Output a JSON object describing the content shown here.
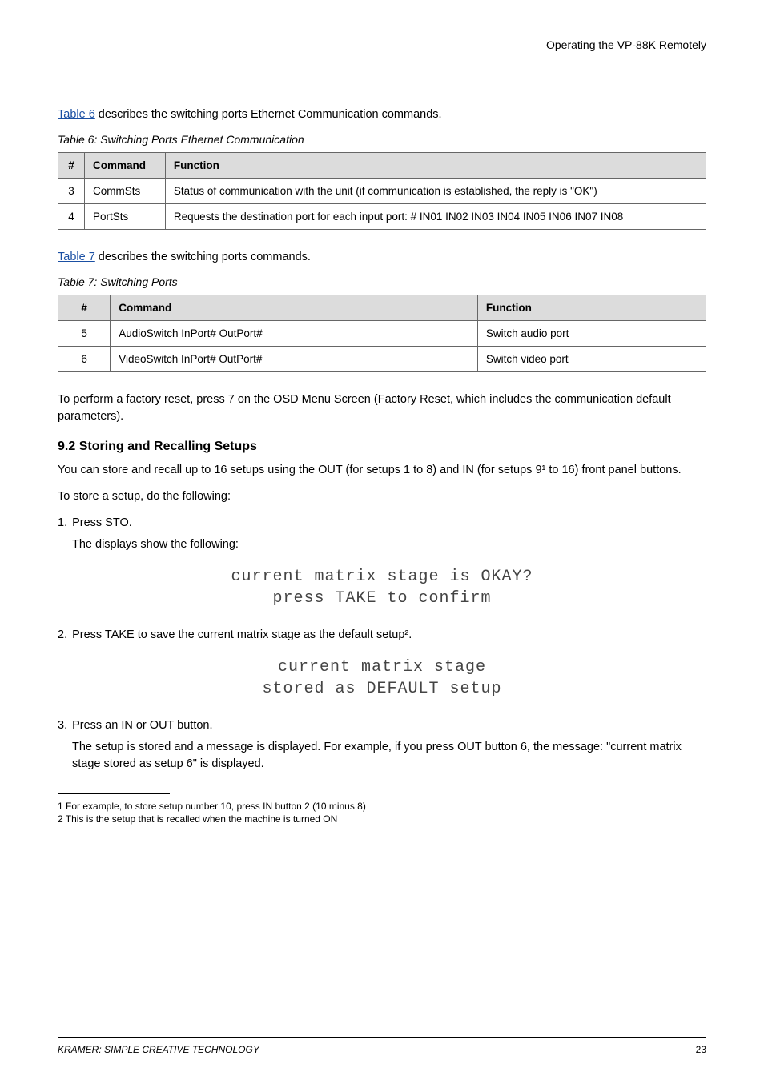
{
  "header": {
    "title": "Operating the VP-88K Remotely"
  },
  "para_sections": {
    "p_intro_t6": "Table 6 describes the switching ports Ethernet Communication commands.",
    "t6_caption": "Table 6: Switching Ports Ethernet Communication",
    "p_intro_t7": "Table 7 describes the switching ports commands.",
    "t7_caption": "Table 7: Switching Ports",
    "p_factory_reset": "To perform a factory reset, press 7 on the OSD Menu Screen (Factory Reset, which includes the communication default parameters)."
  },
  "table6": {
    "headers": [
      "#",
      "Command",
      "Function"
    ],
    "rows": [
      {
        "num": "3",
        "cmd": "CommSts",
        "func": "Status of communication with the unit (if communication is established, the reply is \"OK\")"
      },
      {
        "num": "4",
        "cmd": "PortSts",
        "func": "Requests the destination port for each input port: # IN01 IN02 IN03 IN04 IN05 IN06 IN07 IN08"
      }
    ]
  },
  "table7": {
    "headers": [
      "#",
      "Command",
      "Function"
    ],
    "rows": [
      {
        "num": "5",
        "cmd": "AudioSwitch InPort# OutPort#",
        "func": "Switch audio port"
      },
      {
        "num": "6",
        "cmd": "VideoSwitch InPort# OutPort#",
        "func": "Switch video port"
      }
    ]
  },
  "sections": {
    "s92": "9.2    Storing and Recalling Setups"
  },
  "paras92": {
    "p1": "You can store and recall up to 16 setups using the OUT (for setups 1 to 8) and IN (for setups 9¹ to 16) front panel buttons.",
    "p2": "To store a setup, do the following:"
  },
  "steps": {
    "s1": {
      "num": "1.",
      "text": "Press STO.",
      "sub": "The displays show the following:"
    },
    "s2_lcd": {
      "line1": "current matrix stage is OKAY?",
      "line2": "press TAKE to confirm"
    },
    "s2": {
      "num": "2.",
      "text": "Press TAKE to save the current matrix stage as the default setup²."
    },
    "s2_lcd2": {
      "line1": "current matrix stage",
      "line2": "stored as DEFAULT setup"
    },
    "s3": {
      "num": "3.",
      "text": "Press an IN or OUT button.",
      "sub": "The setup is stored and a message is displayed. For example, if you press OUT button 6, the message: \"current matrix stage stored as setup 6\" is displayed."
    }
  },
  "footnotes": {
    "f1": "1 For example, to store setup number 10, press IN button 2 (10 minus 8)",
    "f2": "2 This is the setup that is recalled when the machine is turned ON"
  },
  "footer": {
    "left": "KRAMER: SIMPLE CREATIVE TECHNOLOGY",
    "right": "23"
  }
}
